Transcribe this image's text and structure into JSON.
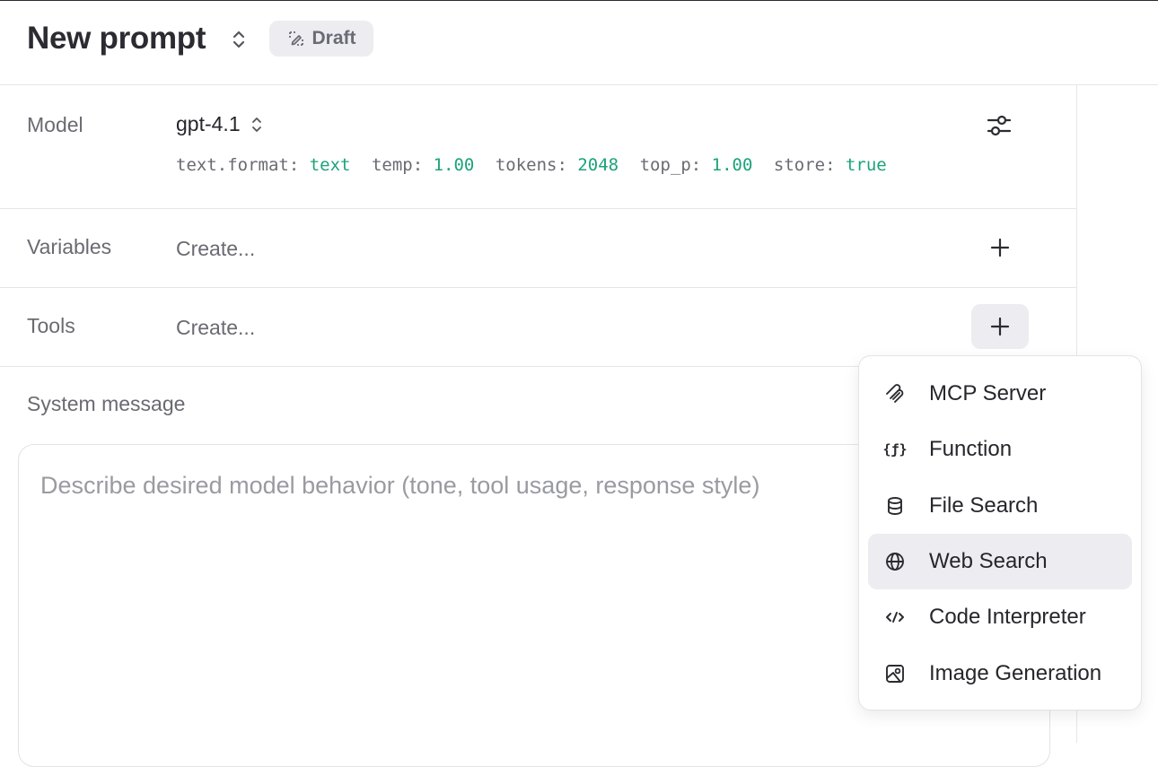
{
  "header": {
    "title": "New prompt",
    "badge": "Draft"
  },
  "model": {
    "label": "Model",
    "name": "gpt-4.1",
    "params": [
      {
        "key": "text.format:",
        "value": "text"
      },
      {
        "key": "temp:",
        "value": "1.00"
      },
      {
        "key": "tokens:",
        "value": "2048"
      },
      {
        "key": "top_p:",
        "value": "1.00"
      },
      {
        "key": "store:",
        "value": "true"
      }
    ]
  },
  "variables": {
    "label": "Variables",
    "value": "Create..."
  },
  "tools": {
    "label": "Tools",
    "value": "Create...",
    "menu": [
      {
        "label": "MCP Server",
        "icon": "mcp-icon",
        "active": false
      },
      {
        "label": "Function",
        "icon": "function-icon",
        "active": false
      },
      {
        "label": "File Search",
        "icon": "database-icon",
        "active": false
      },
      {
        "label": "Web Search",
        "icon": "globe-icon",
        "active": true
      },
      {
        "label": "Code Interpreter",
        "icon": "code-icon",
        "active": false
      },
      {
        "label": "Image Generation",
        "icon": "image-icon",
        "active": false
      }
    ]
  },
  "system_message": {
    "label": "System message",
    "placeholder": "Describe desired model behavior (tone, tool usage, response style)"
  },
  "colors": {
    "param_value": "#1ba37a",
    "badge_bg": "#ececf1",
    "active_item_bg": "#ececf1"
  }
}
